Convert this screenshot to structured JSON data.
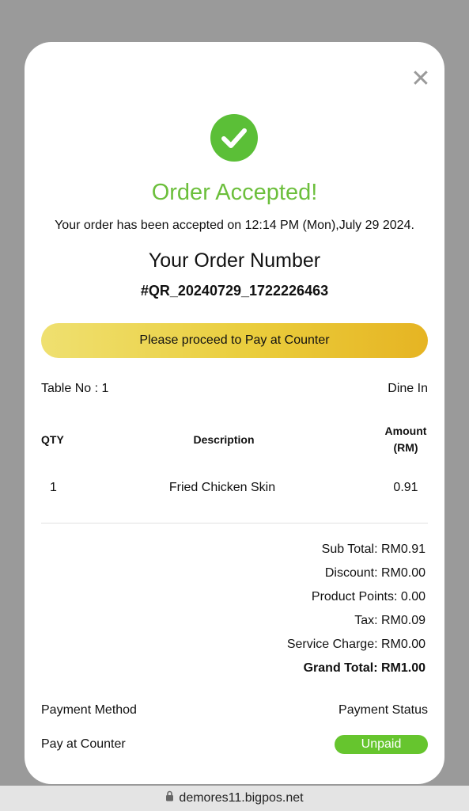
{
  "modal": {
    "close_icon": "close-icon",
    "status_icon": "checkmark-icon",
    "title": "Order Accepted!",
    "accepted_message": "Your order has been accepted on 12:14 PM (Mon),July 29 2024.",
    "order_number_label": "Your Order Number",
    "order_number": "#QR_20240729_1722226463",
    "pay_banner": "Please proceed to Pay at Counter",
    "table_no": "Table No : 1",
    "order_type": "Dine In",
    "table_headers": {
      "qty": "QTY",
      "description": "Description",
      "amount_line1": "Amount",
      "amount_line2": "(RM)"
    },
    "items": [
      {
        "qty": "1",
        "description": "Fried Chicken Skin",
        "amount": "0.91"
      }
    ],
    "totals": {
      "sub_total": "Sub Total: RM0.91",
      "discount": "Discount: RM0.00",
      "product_points": "Product Points: 0.00",
      "tax": "Tax: RM0.09",
      "service_charge": "Service Charge: RM0.00",
      "grand_total": "Grand Total: RM1.00"
    },
    "payment": {
      "method_label": "Payment Method",
      "status_label": "Payment Status",
      "method_value": "Pay at Counter",
      "status_value": "Unpaid"
    }
  },
  "browser": {
    "url": "demores11.bigpos.net",
    "lock_icon": "lock-icon"
  },
  "colors": {
    "success": "#5bbf37",
    "title_green": "#6cbf3c",
    "banner_start": "#efe070",
    "banner_end": "#e6b423",
    "unpaid_badge": "#66c52e",
    "backdrop": "#9a9a9a"
  }
}
